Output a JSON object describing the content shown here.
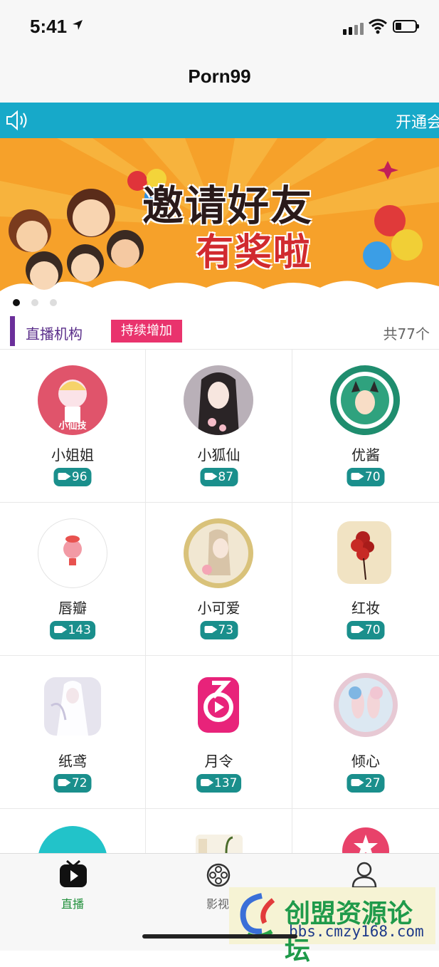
{
  "status_bar": {
    "time": "5:41"
  },
  "nav": {
    "title": "Porn99"
  },
  "notice": {
    "text": "开通会"
  },
  "banner": {
    "line1": "邀请好友",
    "line2": "有奖啦"
  },
  "section": {
    "title": "直播机构",
    "badge": "持续增加",
    "count": "共77个"
  },
  "items": [
    {
      "name": "小姐姐",
      "count": "96",
      "avatar_color": "#e0546b",
      "avatar_text": "小仙技"
    },
    {
      "name": "小狐仙",
      "count": "87",
      "avatar_color": "#b9b0b8",
      "avatar_text": ""
    },
    {
      "name": "优酱",
      "count": "70",
      "avatar_color": "#1f8d6e",
      "avatar_text": ""
    },
    {
      "name": "唇瓣",
      "count": "143",
      "avatar_color": "#ffffff",
      "avatar_text": ""
    },
    {
      "name": "小可爱",
      "count": "73",
      "avatar_color": "#d9c27a",
      "avatar_text": ""
    },
    {
      "name": "红妆",
      "count": "70",
      "avatar_color": "#f1e3c3",
      "avatar_text": ""
    },
    {
      "name": "纸鸢",
      "count": "72",
      "avatar_color": "#e6e4ee",
      "avatar_text": ""
    },
    {
      "name": "月令",
      "count": "137",
      "avatar_color": "#e8237a",
      "avatar_text": ""
    },
    {
      "name": "倾心",
      "count": "27",
      "avatar_color": "#e7c9d4",
      "avatar_text": ""
    }
  ],
  "tabs": [
    {
      "label": "直播",
      "active": true
    },
    {
      "label": "影视",
      "active": false
    },
    {
      "label": "",
      "active": false
    }
  ],
  "watermark": {
    "title": "创盟资源论坛",
    "url": "bbs.cmzy168.com"
  },
  "colors": {
    "notice_bg": "#17a9c9",
    "accent_green": "#1a8f8c",
    "badge_pink": "#e9336d",
    "section_purple": "#6b2f9a",
    "active_tab": "#1f8f3a"
  }
}
